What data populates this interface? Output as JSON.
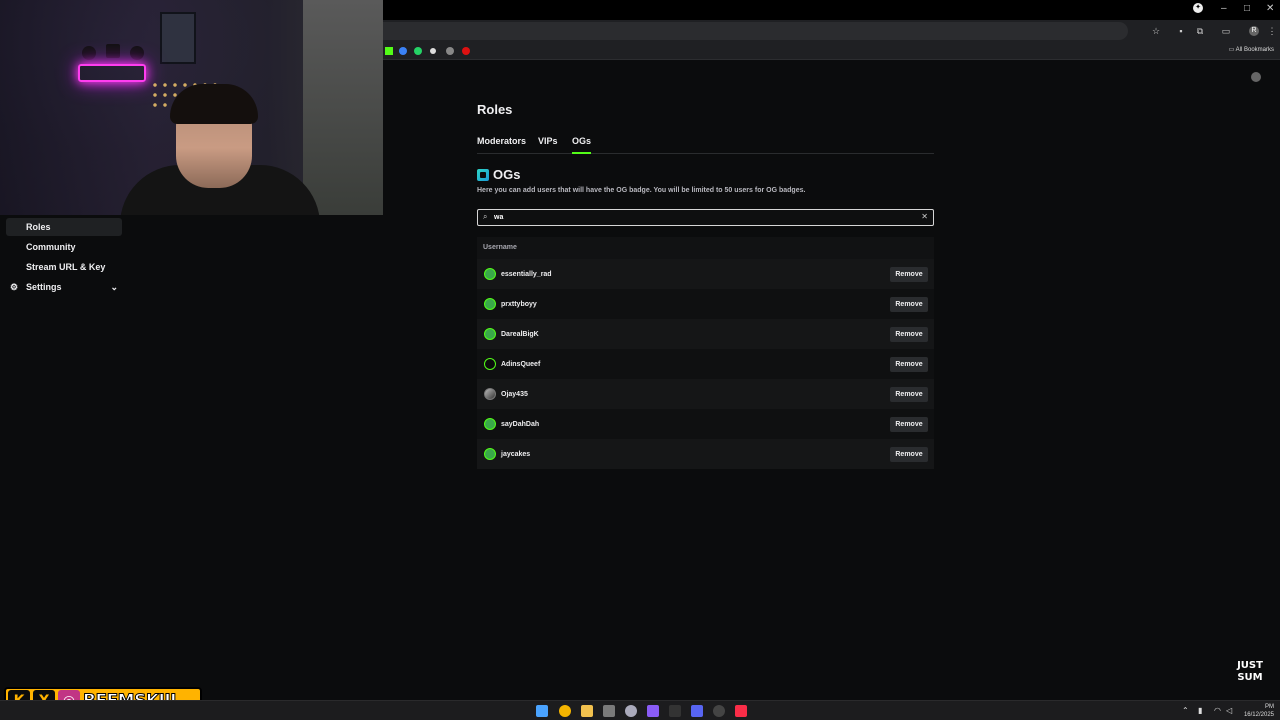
{
  "browser": {
    "all_bookmarks_label": "All Bookmarks"
  },
  "sidebar": {
    "items": [
      {
        "label": "Roles",
        "active": true
      },
      {
        "label": "Community",
        "active": false
      },
      {
        "label": "Stream URL & Key",
        "active": false
      },
      {
        "label": "Settings",
        "active": false
      }
    ]
  },
  "page": {
    "title": "Roles",
    "tabs": [
      "Moderators",
      "VIPs",
      "OGs"
    ],
    "active_tab": "OGs",
    "section_title": "OGs",
    "section_description": "Here you can add users that will have the OG badge. You will be limited to 50 users for OG badges.",
    "search_value": "wa"
  },
  "table": {
    "header": "Username",
    "rows": [
      {
        "username": "essentially_rad",
        "action": "Remove",
        "avatar": "green"
      },
      {
        "username": "prxttyboyy",
        "action": "Remove",
        "avatar": "green"
      },
      {
        "username": "DarealBigK",
        "action": "Remove",
        "avatar": "green"
      },
      {
        "username": "AdinsQueef",
        "action": "Remove",
        "avatar": "dark"
      },
      {
        "username": "Ojay435",
        "action": "Remove",
        "avatar": "gray"
      },
      {
        "username": "sayDahDah",
        "action": "Remove",
        "avatar": "green"
      },
      {
        "username": "jaycakes",
        "action": "Remove",
        "avatar": "green"
      }
    ]
  },
  "overlay": {
    "brand_text": "BEEMSKIII",
    "sticker_text": "JUST SUM"
  },
  "taskbar": {
    "date": "16/12/2025",
    "time_suffix": "PM"
  },
  "colors": {
    "accent": "#53fc18",
    "background": "#0b0c0d"
  }
}
